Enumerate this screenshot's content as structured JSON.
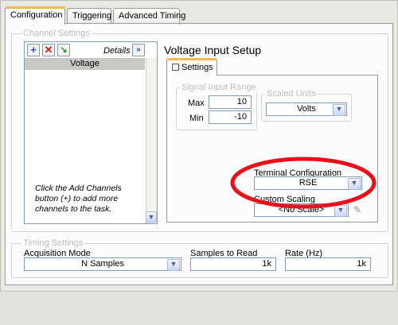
{
  "tabs": [
    {
      "label": "Configuration"
    },
    {
      "label": "Triggering"
    },
    {
      "label": "Advanced Timing"
    }
  ],
  "channel_settings": {
    "group_label": "Channel Settings",
    "details_label": "Details",
    "details_icon": "double-chevron-right-icon",
    "add_icon": "plus-icon",
    "remove_icon": "x-icon",
    "reorder_icon": "arrow-icon",
    "channels": [
      "Voltage"
    ],
    "hint": "Click the Add Channels button (+) to add more channels to the task."
  },
  "setup": {
    "title": "Voltage Input Setup",
    "settings_tab": "Settings",
    "signal_range": {
      "label": "Signal Input Range",
      "max_label": "Max",
      "max_value": "10",
      "min_label": "Min",
      "min_value": "-10"
    },
    "scaled_units": {
      "label": "Scaled Units",
      "value": "Volts"
    },
    "terminal_config": {
      "label": "Terminal Configuration",
      "value": "RSE"
    },
    "custom_scaling": {
      "label": "Custom Scaling",
      "value": "<No Scale>"
    }
  },
  "timing": {
    "group_label": "Timing Settings",
    "acquisition_mode": {
      "label": "Acquisition Mode",
      "value": "N Samples"
    },
    "samples_to_read": {
      "label": "Samples to Read",
      "value": "1k"
    },
    "rate": {
      "label": "Rate (Hz)",
      "value": "1k"
    }
  },
  "colors": {
    "highlight_ellipse": "#e8101a",
    "active_tab_accent": "#f4b84b",
    "selected_channel": "#c8c8c4"
  }
}
